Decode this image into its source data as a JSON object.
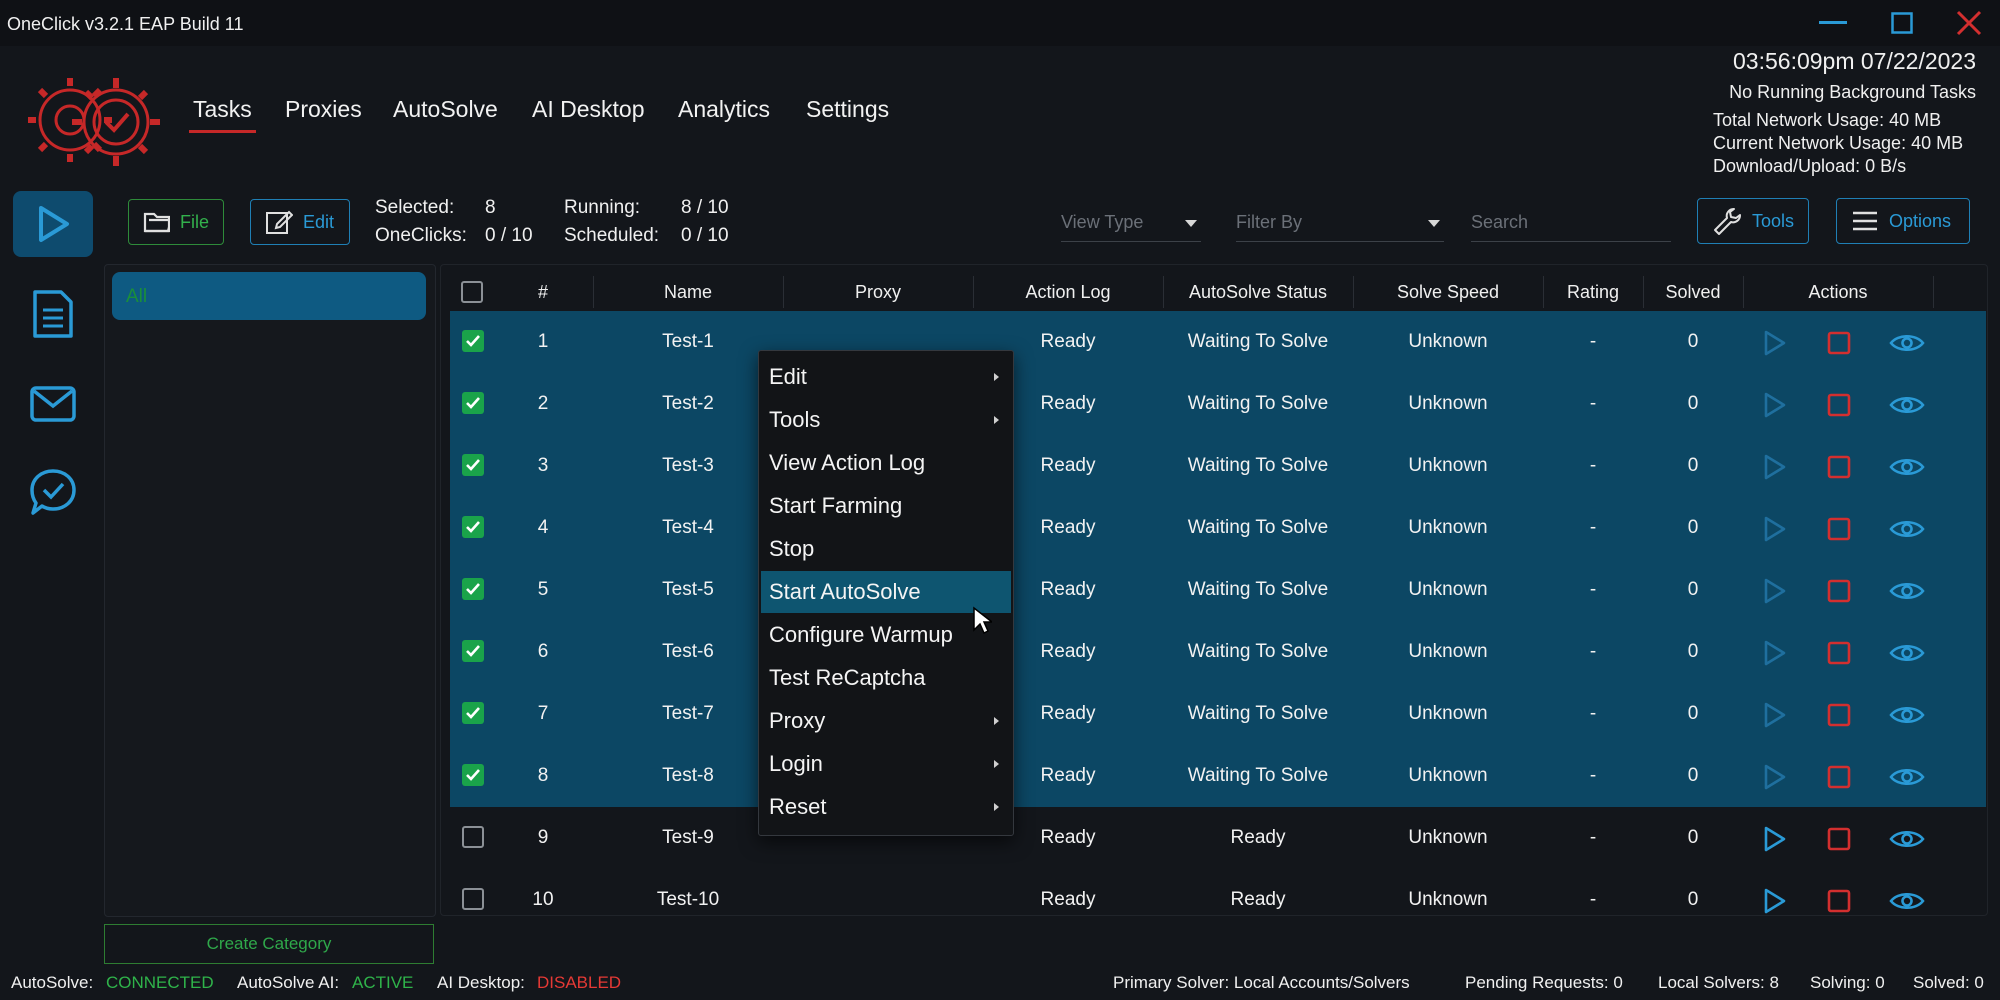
{
  "app": {
    "title": "OneClick v3.2.1 EAP Build 11"
  },
  "nav": [
    {
      "label": "Tasks",
      "active": true
    },
    {
      "label": "Proxies"
    },
    {
      "label": "AutoSolve"
    },
    {
      "label": "AI Desktop"
    },
    {
      "label": "Analytics"
    },
    {
      "label": "Settings"
    }
  ],
  "header": {
    "datetime": "03:56:09pm 07/22/2023",
    "bg_tasks": "No Running Background Tasks",
    "total_network": "Total Network Usage:  40 MB",
    "current_network": "Current Network Usage: 40 MB",
    "download_upload": "Download/Upload: 0 B/s"
  },
  "toolbar": {
    "file_label": "File",
    "edit_label": "Edit",
    "selected_label": "Selected:",
    "selected_value": "8",
    "oneclicks_label": "OneClicks:",
    "oneclicks_value": "0 / 10",
    "running_label": "Running:",
    "running_value": "8 / 10",
    "scheduled_label": "Scheduled:",
    "scheduled_value": "0 / 10",
    "view_type_placeholder": "View Type",
    "filter_by_placeholder": "Filter By",
    "search_placeholder": "Search",
    "tools_label": "Tools",
    "options_label": "Options"
  },
  "categories": {
    "all_label": "All",
    "create_label": "Create Category"
  },
  "table": {
    "columns": [
      "#",
      "Name",
      "Proxy",
      "Action Log",
      "AutoSolve Status",
      "Solve Speed",
      "Rating",
      "Solved",
      "Actions"
    ],
    "rows": [
      {
        "num": "1",
        "name": "Test-1",
        "proxy": "",
        "log": "Ready",
        "status": "Waiting To Solve",
        "speed": "Unknown",
        "rating": "-",
        "solved": "0",
        "selected": true
      },
      {
        "num": "2",
        "name": "Test-2",
        "proxy": "",
        "log": "Ready",
        "status": "Waiting To Solve",
        "speed": "Unknown",
        "rating": "-",
        "solved": "0",
        "selected": true
      },
      {
        "num": "3",
        "name": "Test-3",
        "proxy": "",
        "log": "Ready",
        "status": "Waiting To Solve",
        "speed": "Unknown",
        "rating": "-",
        "solved": "0",
        "selected": true
      },
      {
        "num": "4",
        "name": "Test-4",
        "proxy": "",
        "log": "Ready",
        "status": "Waiting To Solve",
        "speed": "Unknown",
        "rating": "-",
        "solved": "0",
        "selected": true
      },
      {
        "num": "5",
        "name": "Test-5",
        "proxy": "",
        "log": "Ready",
        "status": "Waiting To Solve",
        "speed": "Unknown",
        "rating": "-",
        "solved": "0",
        "selected": true
      },
      {
        "num": "6",
        "name": "Test-6",
        "proxy": "",
        "log": "Ready",
        "status": "Waiting To Solve",
        "speed": "Unknown",
        "rating": "-",
        "solved": "0",
        "selected": true
      },
      {
        "num": "7",
        "name": "Test-7",
        "proxy": "",
        "log": "Ready",
        "status": "Waiting To Solve",
        "speed": "Unknown",
        "rating": "-",
        "solved": "0",
        "selected": true
      },
      {
        "num": "8",
        "name": "Test-8",
        "proxy": "",
        "log": "Ready",
        "status": "Waiting To Solve",
        "speed": "Unknown",
        "rating": "-",
        "solved": "0",
        "selected": true
      },
      {
        "num": "9",
        "name": "Test-9",
        "proxy": "",
        "log": "Ready",
        "status": "Ready",
        "speed": "Unknown",
        "rating": "-",
        "solved": "0",
        "selected": false
      },
      {
        "num": "10",
        "name": "Test-10",
        "proxy": "",
        "log": "Ready",
        "status": "Ready",
        "speed": "Unknown",
        "rating": "-",
        "solved": "0",
        "selected": false
      }
    ]
  },
  "context_menu": [
    {
      "label": "Edit",
      "submenu": true
    },
    {
      "label": "Tools",
      "submenu": true
    },
    {
      "label": "View Action Log",
      "submenu": false
    },
    {
      "label": "Start Farming",
      "submenu": false
    },
    {
      "label": "Stop",
      "submenu": false
    },
    {
      "label": "Start AutoSolve",
      "submenu": false,
      "highlighted": true
    },
    {
      "label": "Configure Warmup",
      "submenu": false
    },
    {
      "label": "Test ReCaptcha",
      "submenu": false
    },
    {
      "label": "Proxy",
      "submenu": true
    },
    {
      "label": "Login",
      "submenu": true
    },
    {
      "label": "Reset",
      "submenu": true
    }
  ],
  "status_bar": {
    "autosolve_label": "AutoSolve:",
    "autosolve_value": "CONNECTED",
    "autosolve_ai_label": "AutoSolve AI:",
    "autosolve_ai_value": "ACTIVE",
    "ai_desktop_label": "AI Desktop:",
    "ai_desktop_value": "DISABLED",
    "primary_solver": "Primary Solver: Local Accounts/Solvers",
    "pending": "Pending Requests: 0",
    "local_solvers": "Local Solvers: 8",
    "solving": "Solving: 0",
    "solved": "Solved: 0"
  },
  "colors": {
    "background": "#13161b",
    "accent_blue": "#1e88c8",
    "selected_row": "#0c4764",
    "checkbox_green": "#1aa34a",
    "stop_red": "#d32f2f",
    "connected_green": "#2fb34a",
    "disabled_red": "#e53935"
  },
  "icons": [
    "logo-gear-check-icon",
    "minimize-icon",
    "maximize-icon",
    "close-icon",
    "tasks-play-icon",
    "document-icon",
    "mail-icon",
    "chat-check-icon",
    "folder-icon",
    "edit-icon",
    "wrench-icon",
    "hamburger-icon",
    "play-icon",
    "stop-icon",
    "eye-icon"
  ]
}
